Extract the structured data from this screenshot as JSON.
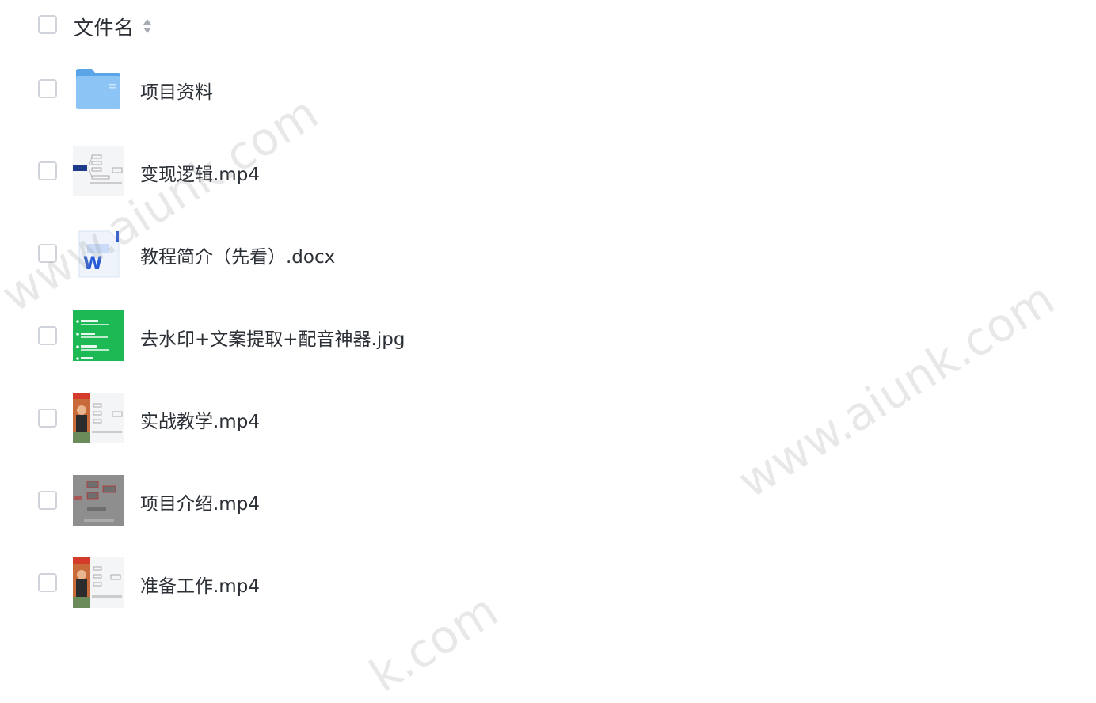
{
  "header": {
    "title": "文件名"
  },
  "files": [
    {
      "name": "项目资料",
      "icon": "folder-icon"
    },
    {
      "name": "变现逻辑.mp4",
      "icon": "video-thumbnail"
    },
    {
      "name": "教程简介（先看）.docx",
      "icon": "word-doc-icon"
    },
    {
      "name": "去水印+文案提取+配音神器.jpg",
      "icon": "image-thumbnail"
    },
    {
      "name": "实战教学.mp4",
      "icon": "video-thumbnail"
    },
    {
      "name": "项目介绍.mp4",
      "icon": "video-thumbnail"
    },
    {
      "name": "准备工作.mp4",
      "icon": "video-thumbnail"
    }
  ],
  "watermark": {
    "text_1": "www.aiunk.com",
    "text_2": "www.aiunk.com",
    "text_3": "k.com"
  },
  "colors": {
    "text": "#2b2f36",
    "checkbox_border": "#d0d3d9",
    "folder": "#6cb3f0",
    "word_blue": "#2a5bd7",
    "green_thumb": "#1db954"
  }
}
